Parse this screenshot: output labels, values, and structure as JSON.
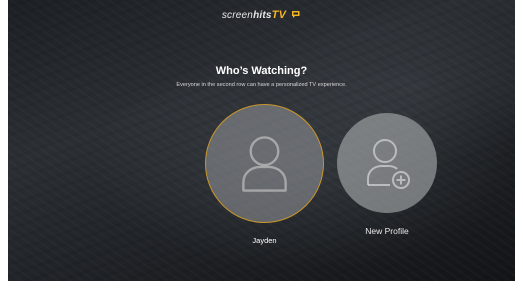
{
  "header": {
    "logo_part1": "screen",
    "logo_part2": "hits",
    "logo_part3": "TV",
    "logo_mark_icon": "chat-bubble-icon",
    "logo_accent": "#f3b425"
  },
  "main": {
    "title": "Who’s Watching?",
    "subtitle": "Everyone in the second row can have a personalized TV experience."
  },
  "profiles": [
    {
      "name": "Jayden",
      "icon": "user-icon",
      "selected": true,
      "highlight_color": "#c9962a"
    },
    {
      "name": "New Profile",
      "icon": "add-user-icon",
      "selected": false
    }
  ]
}
